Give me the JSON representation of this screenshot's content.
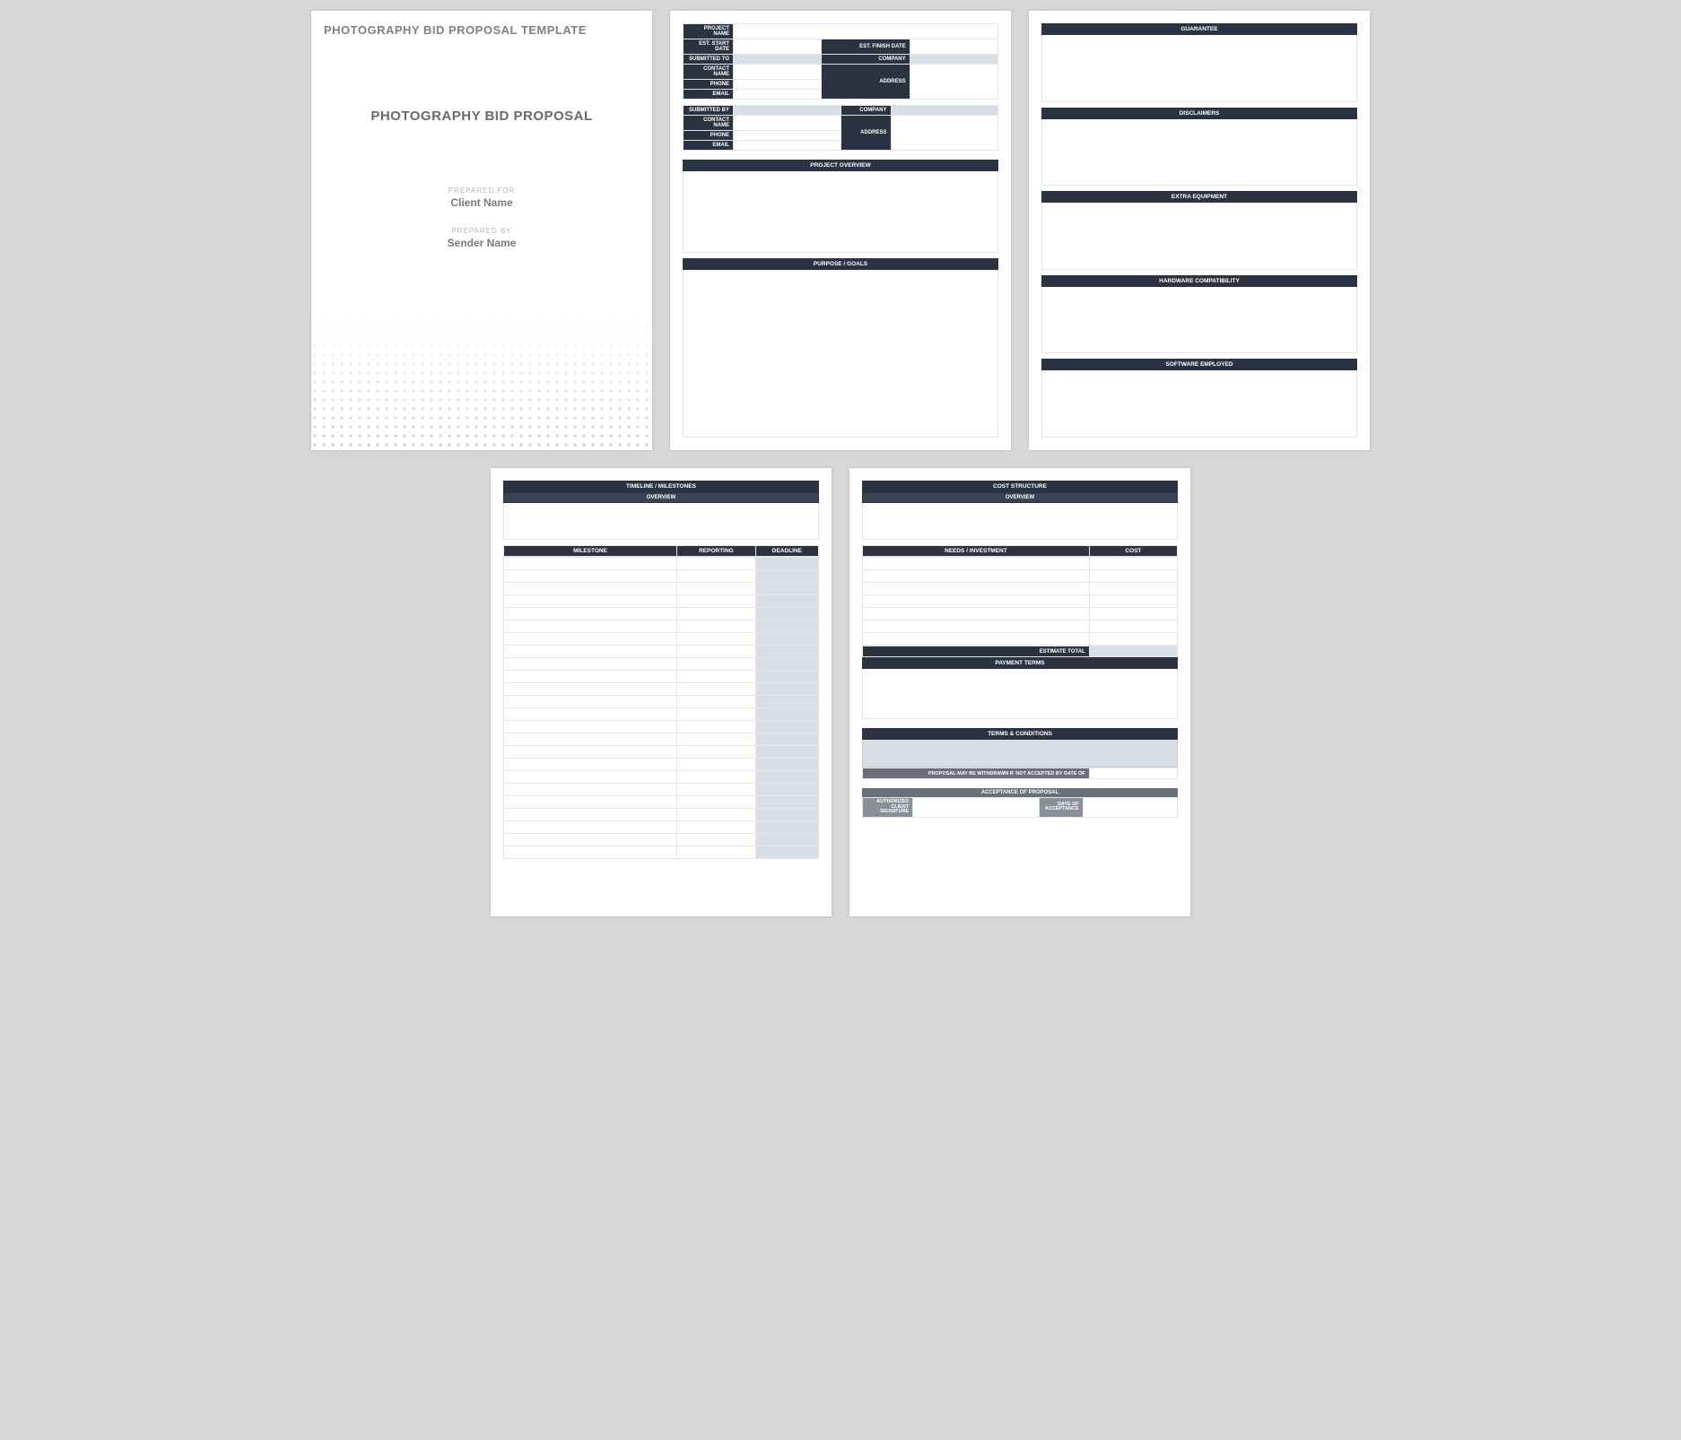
{
  "page1": {
    "template_title": "PHOTOGRAPHY BID PROPOSAL TEMPLATE",
    "main_title": "PHOTOGRAPHY BID PROPOSAL",
    "prepared_for_label": "PREPARED FOR",
    "prepared_for_value": "Client Name",
    "prepared_by_label": "PREPARED BY",
    "prepared_by_value": "Sender Name"
  },
  "page2": {
    "info_labels": {
      "project_name": "PROJECT NAME",
      "est_start": "EST. START DATE",
      "est_finish": "EST. FINISH DATE",
      "submitted_to": "SUBMITTED TO",
      "company_to": "COMPANY",
      "contact_to": "CONTACT NAME",
      "address_to": "ADDRESS",
      "phone_to": "PHONE",
      "email_to": "EMAIL",
      "submitted_by": "SUBMITTED BY",
      "company_by": "COMPANY",
      "contact_by": "CONTACT NAME",
      "address_by": "ADDRESS",
      "phone_by": "PHONE",
      "email_by": "EMAIL"
    },
    "project_overview_hdr": "PROJECT OVERVIEW",
    "purpose_hdr": "PURPOSE / GOALS"
  },
  "page3": {
    "guarantee": "GUARANTEE",
    "disclaimers": "DISCLAIMERS",
    "extra_equipment": "EXTRA EQUIPMENT",
    "hardware": "HARDWARE COMPATIBILITY",
    "software": "SOFTWARE EMPLOYED"
  },
  "page4": {
    "timeline_hdr": "TIMELINE / MILESTONES",
    "overview": "OVERVIEW",
    "col_milestone": "MILESTONE",
    "col_reporting": "REPORTING",
    "col_deadline": "DEADLINE"
  },
  "page5": {
    "cost_hdr": "COST STRUCTURE",
    "overview": "OVERVIEW",
    "col_needs": "NEEDS / INVESTMENT",
    "col_cost": "COST",
    "estimate_total": "ESTIMATE TOTAL",
    "payment_terms": "PAYMENT TERMS",
    "terms": "TERMS & CONDITIONS",
    "withdrawn": "PROPOSAL MAY BE WITHDRAWN IF NOT ACCEPTED BY DATE OF",
    "acceptance": "ACCEPTANCE OF PROPOSAL",
    "auth_sig": "AUTHORIZED CLIENT SIGNATURE",
    "date_accept": "DATE OF ACCEPTANCE"
  }
}
